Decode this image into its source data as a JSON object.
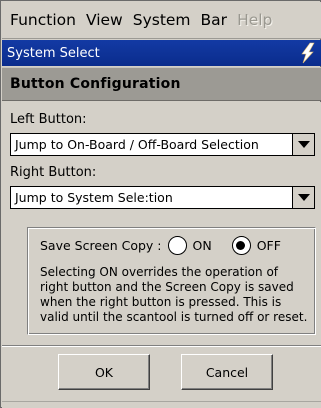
{
  "menubar": {
    "items": [
      {
        "label": "Function",
        "enabled": true
      },
      {
        "label": "View",
        "enabled": true
      },
      {
        "label": "System",
        "enabled": true
      },
      {
        "label": "Bar",
        "enabled": true
      },
      {
        "label": "Help",
        "enabled": false
      }
    ]
  },
  "titlebar": {
    "title": "System Select",
    "icon": "lightning-icon"
  },
  "header": {
    "title": "Button Configuration"
  },
  "left_button": {
    "label": "Left Button:",
    "value": "Jump to On-Board / Off-Board Selection"
  },
  "right_button": {
    "label": "Right Button:",
    "value": "Jump to System Sele:tion"
  },
  "screen_copy": {
    "label": "Save Screen Copy :",
    "on_label": "ON",
    "off_label": "OFF",
    "selected": "OFF",
    "description": "Selecting ON overrides the operation of right button and the Screen Copy is saved when the right button is pressed. This is valid until the scantool is turned off or reset."
  },
  "footer": {
    "ok_label": "OK",
    "cancel_label": "Cancel"
  },
  "colors": {
    "window_bg": "#d4d0c8",
    "titlebar_bg": "#0a2c8c",
    "header_bg": "#9c9a94",
    "disabled_text": "#9a9890"
  }
}
